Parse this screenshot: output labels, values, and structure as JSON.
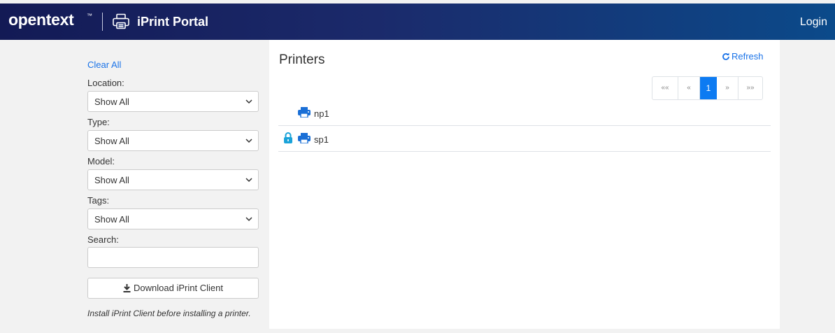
{
  "header": {
    "brand": "opentext",
    "brand_tm": "™",
    "title": "iPrint Portal",
    "login": "Login"
  },
  "sidebar": {
    "clear_all": "Clear All",
    "filters": [
      {
        "label": "Location:",
        "value": "Show All"
      },
      {
        "label": "Type:",
        "value": "Show All"
      },
      {
        "label": "Model:",
        "value": "Show All"
      },
      {
        "label": "Tags:",
        "value": "Show All"
      }
    ],
    "search_label": "Search:",
    "search_value": "",
    "download_button": "Download iPrint Client",
    "hint": "Install iPrint Client before installing a printer."
  },
  "main": {
    "title": "Printers",
    "refresh": "Refresh",
    "pagination": {
      "first": "««",
      "prev": "«",
      "current": "1",
      "next": "»",
      "last": "»»"
    },
    "printers": [
      {
        "name": "np1",
        "locked": false
      },
      {
        "name": "sp1",
        "locked": true
      }
    ]
  },
  "colors": {
    "accent": "#1a73e8",
    "icon_blue": "#1a6fd6",
    "lock": "#1aa3d9",
    "active_page": "#0d7bf2"
  }
}
